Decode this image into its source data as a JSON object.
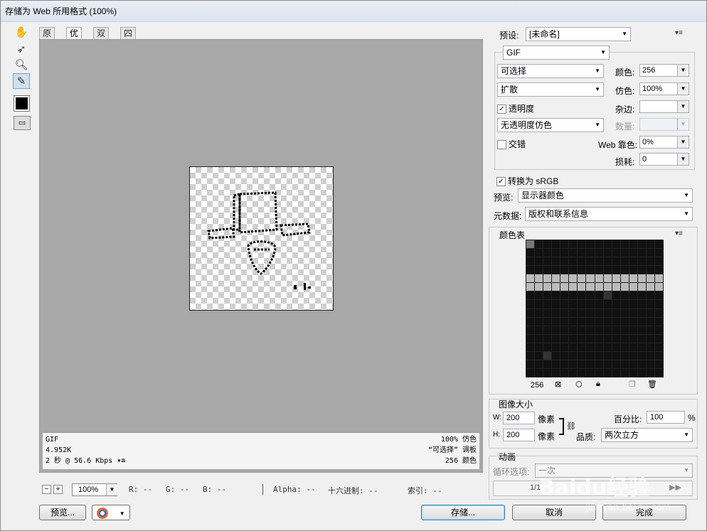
{
  "window": {
    "title": "存储为 Web 所用格式 (100%)"
  },
  "tabs": [
    {
      "label": "原稿",
      "active": false
    },
    {
      "label": "优化",
      "active": true
    },
    {
      "label": "双联",
      "active": false
    },
    {
      "label": "四联",
      "active": false
    }
  ],
  "tools": {
    "hand": "hand-icon",
    "slice_select": "slice-select-icon",
    "zoom": "zoom-icon",
    "eyedropper": "eyedropper-icon"
  },
  "info": {
    "format": "GIF",
    "size": "4.952K",
    "speed": "2 秒 @ 56.6 Kbps",
    "dither": "100% 仿色",
    "palette": "“可选择” 调板",
    "colors": "256 颜色"
  },
  "status": {
    "zoom": "100%",
    "r": "R: --",
    "g": "G: --",
    "b": "B: --",
    "alpha": "Alpha: --",
    "hex": "十六进制: --",
    "index": "索引: --"
  },
  "buttons": {
    "preview": "预览...",
    "save": "存储...",
    "cancel": "取消",
    "done": "完成"
  },
  "settings": {
    "preset_label": "预设:",
    "preset_value": "[未命名]",
    "format": "GIF",
    "reduction": "可选择",
    "dither_algo": "扩散",
    "colors_label": "颜色:",
    "colors_value": "256",
    "dither_label": "仿色:",
    "dither_value": "100%",
    "transparency": "透明度",
    "transparency_checked": true,
    "matte_label": "杂边:",
    "matte_value": "",
    "trans_dither": "无透明度仿色",
    "amount_label": "数量:",
    "interlaced": "交错",
    "interlaced_checked": false,
    "web_snap_label": "Web 靠色:",
    "web_snap_value": "0%",
    "lossy_label": "损耗:",
    "lossy_value": "0",
    "convert_srgb": "转换为 sRGB",
    "convert_srgb_checked": true,
    "preview_label": "预览:",
    "preview_value": "显示器颜色",
    "metadata_label": "元数据:",
    "metadata_value": "版权和联系信息"
  },
  "color_table": {
    "title": "颜色表",
    "count": "256"
  },
  "image_size": {
    "title": "图像大小",
    "w_label": "W:",
    "w_value": "200",
    "h_label": "H:",
    "h_value": "200",
    "unit": "像素",
    "percent_label": "百分比:",
    "percent_value": "100",
    "percent_unit": "%",
    "quality_label": "品质:",
    "quality_value": "两次立方"
  },
  "animation": {
    "title": "动画",
    "loop_label": "循环选项:",
    "loop_value": "一次",
    "frame": "1/1"
  },
  "watermark": {
    "brand": "Baidu经验",
    "url": "jingyan.baidu.com"
  },
  "colors": {
    "accent": "#3c7fb1",
    "viewer_bg": "#a8a8a8"
  }
}
